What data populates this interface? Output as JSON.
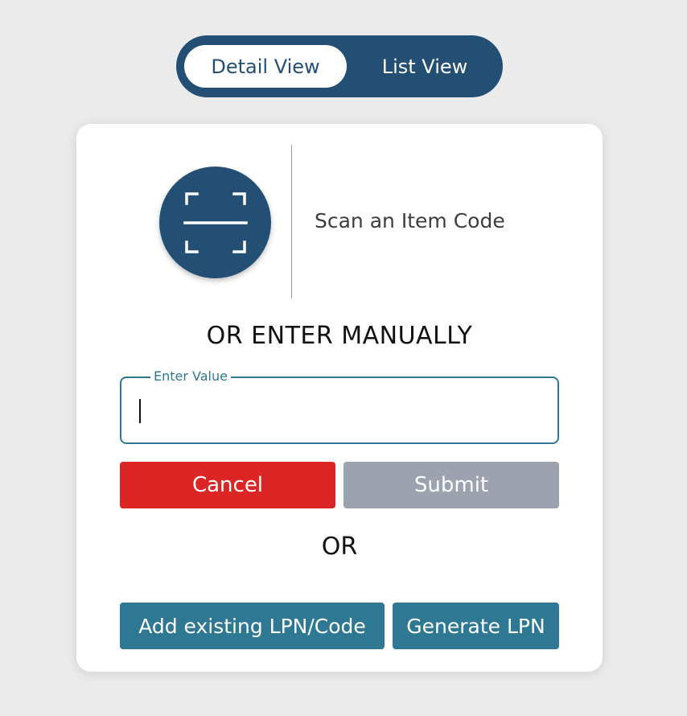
{
  "view_toggle": {
    "options": [
      "Detail View",
      "List View"
    ],
    "selected": "Detail View"
  },
  "scan": {
    "icon": "scan-icon",
    "label": "Scan an Item Code"
  },
  "manual": {
    "heading": "OR ENTER MANUALLY",
    "field_label": "Enter Value",
    "field_value": ""
  },
  "actions": {
    "cancel_label": "Cancel",
    "submit_label": "Submit"
  },
  "separator": "OR",
  "lpn": {
    "add_existing_label": "Add existing LPN/Code",
    "generate_label": "Generate LPN"
  },
  "colors": {
    "primary": "#244f75",
    "accent": "#2e7894",
    "danger": "#dc2626",
    "disabled": "#9ca3af",
    "background": "#ebebeb"
  }
}
